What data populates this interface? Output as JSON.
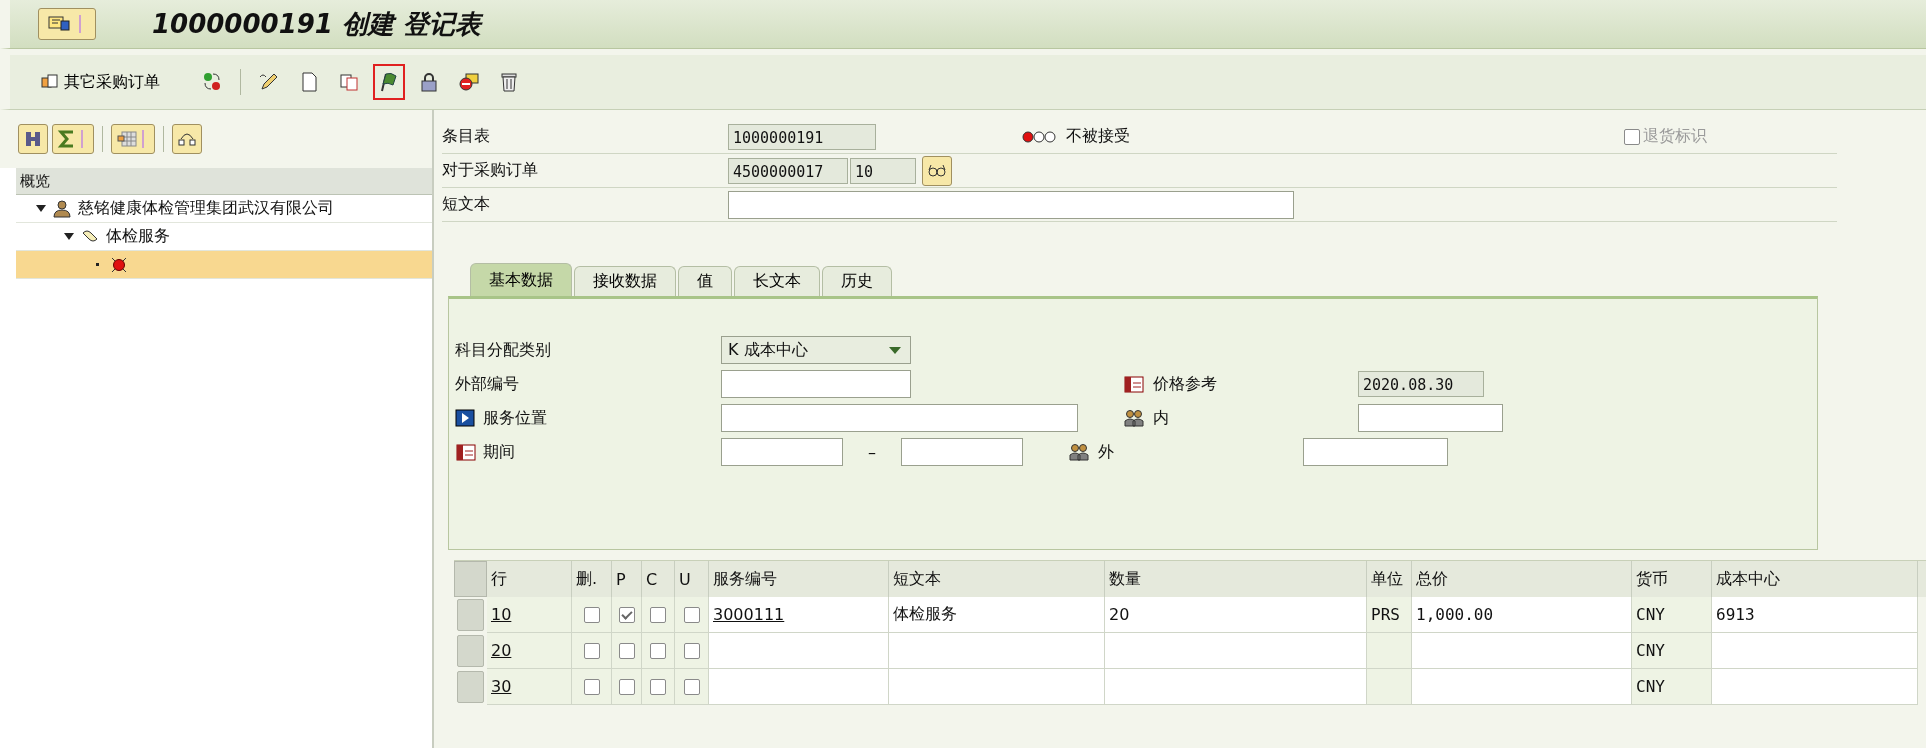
{
  "window": {
    "title": "1000000191 创建 登记表"
  },
  "toolbar": {
    "other_po_label": "其它采购订单",
    "icons": [
      {
        "kind": "swap",
        "highlighted": false
      },
      {
        "kind": "pencil",
        "highlighted": false
      },
      {
        "kind": "page",
        "highlighted": false
      },
      {
        "kind": "copy",
        "highlighted": false
      },
      {
        "kind": "flag",
        "highlighted": true
      },
      {
        "kind": "lock",
        "highlighted": false
      },
      {
        "kind": "stop",
        "highlighted": false
      },
      {
        "kind": "trash",
        "highlighted": false
      }
    ]
  },
  "overview": {
    "header": "概览",
    "items": [
      {
        "kind": "person",
        "label": "慈铭健康体检管理集团武汉有限公司",
        "expanded": true,
        "selected": false,
        "children": [
          {
            "kind": "service",
            "label": "体检服务",
            "expanded": true,
            "selected": false,
            "children": [
              {
                "kind": "status",
                "selected": true
              }
            ]
          }
        ]
      }
    ]
  },
  "header": {
    "entry_sheet": {
      "label": "条目表",
      "value": "1000000191"
    },
    "status": {
      "lights": [
        {
          "on": true
        },
        {
          "on": false
        },
        {
          "on": false
        }
      ],
      "label": "不被接受"
    },
    "return_flag": {
      "label": "退货标识",
      "checked": false,
      "disabled": true
    },
    "purchase_order": {
      "label": "对于采购订单",
      "number": "4500000017",
      "item": "10"
    },
    "short_text": {
      "label": "短文本"
    }
  },
  "tabs": [
    {
      "label": "基本数据",
      "selected": true
    },
    {
      "label": "接收数据",
      "selected": false
    },
    {
      "label": "值",
      "selected": false
    },
    {
      "label": "长文本",
      "selected": false
    },
    {
      "label": "历史",
      "selected": false
    }
  ],
  "basic_data": {
    "account_assignment": {
      "label": "科目分配类别",
      "value": "K 成本中心"
    },
    "external_number": {
      "label": "外部编号"
    },
    "service_location": {
      "label": "服务位置"
    },
    "period": {
      "label": "期间",
      "separator": "–"
    },
    "price_reference": {
      "label": "价格参考",
      "value": "2020.08.30"
    },
    "internal": {
      "label": "内"
    },
    "external": {
      "label": "外"
    }
  },
  "table": {
    "columns": [
      "行",
      "删.",
      "P",
      "C",
      "U",
      "服务编号",
      "短文本",
      "数量",
      "单位",
      "总价",
      "货币",
      "成本中心"
    ],
    "rows": [
      {
        "line": "10",
        "deleted": false,
        "p": true,
        "c": false,
        "u": false,
        "service_no": "3000111",
        "short_text": "体检服务",
        "quantity": "20",
        "unit": "PRS",
        "total": "1,000.00",
        "currency": "CNY",
        "cost_center": "6913"
      },
      {
        "line": "20",
        "deleted": false,
        "p": false,
        "c": false,
        "u": false,
        "currency": "CNY"
      },
      {
        "line": "30",
        "deleted": false,
        "p": false,
        "c": false,
        "u": false,
        "currency": "CNY"
      }
    ]
  }
}
